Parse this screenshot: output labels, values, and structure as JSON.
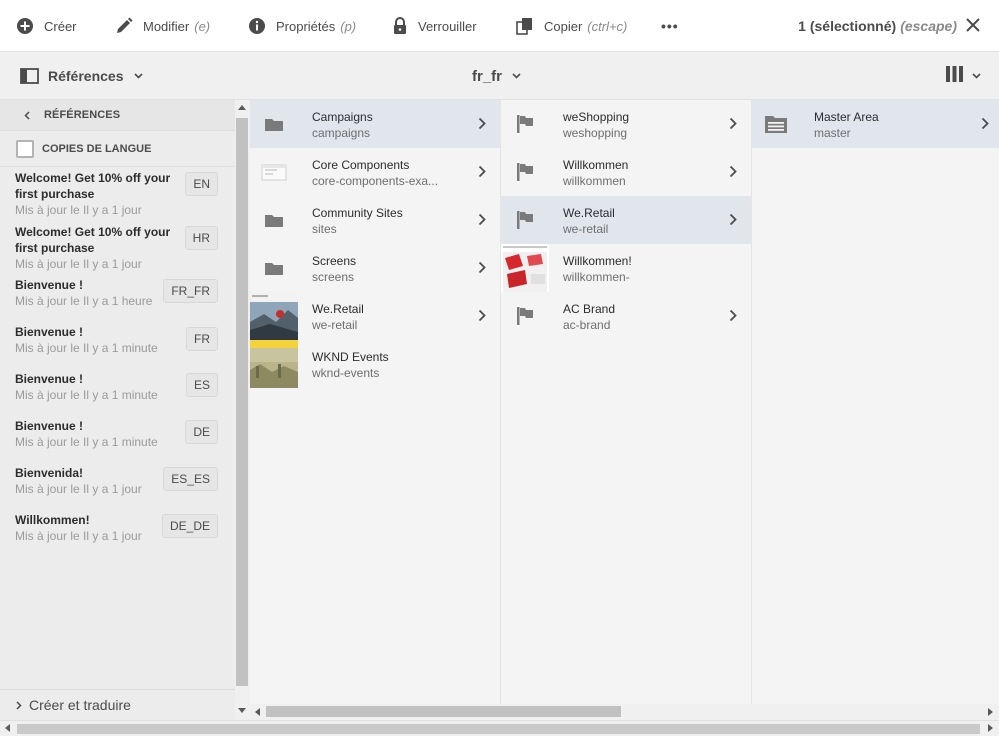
{
  "toolbar": {
    "create_label": "Créer",
    "edit_label": "Modifier",
    "edit_hint": "(e)",
    "properties_label": "Propriétés",
    "properties_hint": "(p)",
    "lock_label": "Verrouiller",
    "copy_label": "Copier",
    "copy_hint": "(ctrl+c)",
    "more_label": "•••",
    "selection_label": "1 (sélectionné)",
    "selection_hint": "(escape)"
  },
  "subbar": {
    "rail_selector": "Références",
    "language": "fr_fr"
  },
  "rail": {
    "header": "RÉFÉRENCES",
    "language_copies_label": "COPIES DE LANGUE",
    "items": [
      {
        "title": "Welcome! Get 10% off your first purchase",
        "sub": "Mis à jour le Il y a 1 jour",
        "badge": "EN"
      },
      {
        "title": "Welcome! Get 10% off your first purchase",
        "sub": "Mis à jour le Il y a 1 jour",
        "badge": "HR"
      },
      {
        "title": "Bienvenue !",
        "sub": "Mis à jour le Il y a 1 heure",
        "badge": "FR_FR"
      },
      {
        "title": "Bienvenue !",
        "sub": "Mis à jour le Il y a 1 minute",
        "badge": "FR"
      },
      {
        "title": "Bienvenue !",
        "sub": "Mis à jour le Il y a 1 minute",
        "badge": "ES"
      },
      {
        "title": "Bienvenue !",
        "sub": "Mis à jour le Il y a 1 minute",
        "badge": "DE"
      },
      {
        "title": "Bienvenida!",
        "sub": "Mis à jour le Il y a 1 jour",
        "badge": "ES_ES"
      },
      {
        "title": "Willkommen!",
        "sub": "Mis à jour le Il y a 1 jour",
        "badge": "DE_DE"
      }
    ],
    "footer": "Créer et traduire"
  },
  "columns": [
    [
      {
        "title": "Campaigns",
        "sub": "campaigns",
        "icon": "folder-icon",
        "selected": true,
        "chevron": true
      },
      {
        "title": "Core Components",
        "sub": "core-components-exa...",
        "icon": "component-icon",
        "selected": false,
        "chevron": true
      },
      {
        "title": "Community Sites",
        "sub": "sites",
        "icon": "folder-icon",
        "selected": false,
        "chevron": true
      },
      {
        "title": "Screens",
        "sub": "screens",
        "icon": "folder-icon",
        "selected": false,
        "chevron": true
      },
      {
        "title": "We.Retail",
        "sub": "we-retail",
        "icon": "photo-thumbnail",
        "selected": false,
        "chevron": true
      },
      {
        "title": "WKND Events",
        "sub": "wknd-events",
        "icon": "photo-thumbnail",
        "selected": false,
        "chevron": false
      }
    ],
    [
      {
        "title": "weShopping",
        "sub": "weshopping",
        "icon": "flag-icon",
        "selected": false,
        "chevron": true
      },
      {
        "title": "Willkommen",
        "sub": "willkommen",
        "icon": "flag-icon",
        "selected": false,
        "chevron": true
      },
      {
        "title": "We.Retail",
        "sub": "we-retail",
        "icon": "flag-icon",
        "selected": true,
        "chevron": true
      },
      {
        "title": "Willkommen!",
        "sub": "willkommen-",
        "icon": "page-thumbnail",
        "selected": false,
        "chevron": false
      },
      {
        "title": "AC Brand",
        "sub": "ac-brand",
        "icon": "flag-icon",
        "selected": false,
        "chevron": true
      }
    ],
    [
      {
        "title": "Master Area",
        "sub": "master",
        "icon": "master-folder-icon",
        "selected": true,
        "chevron": true
      }
    ]
  ],
  "colors": {
    "selected_row": "#e1e6ec",
    "rail_bg": "#ececec",
    "content_bg": "#f4f4f4"
  }
}
